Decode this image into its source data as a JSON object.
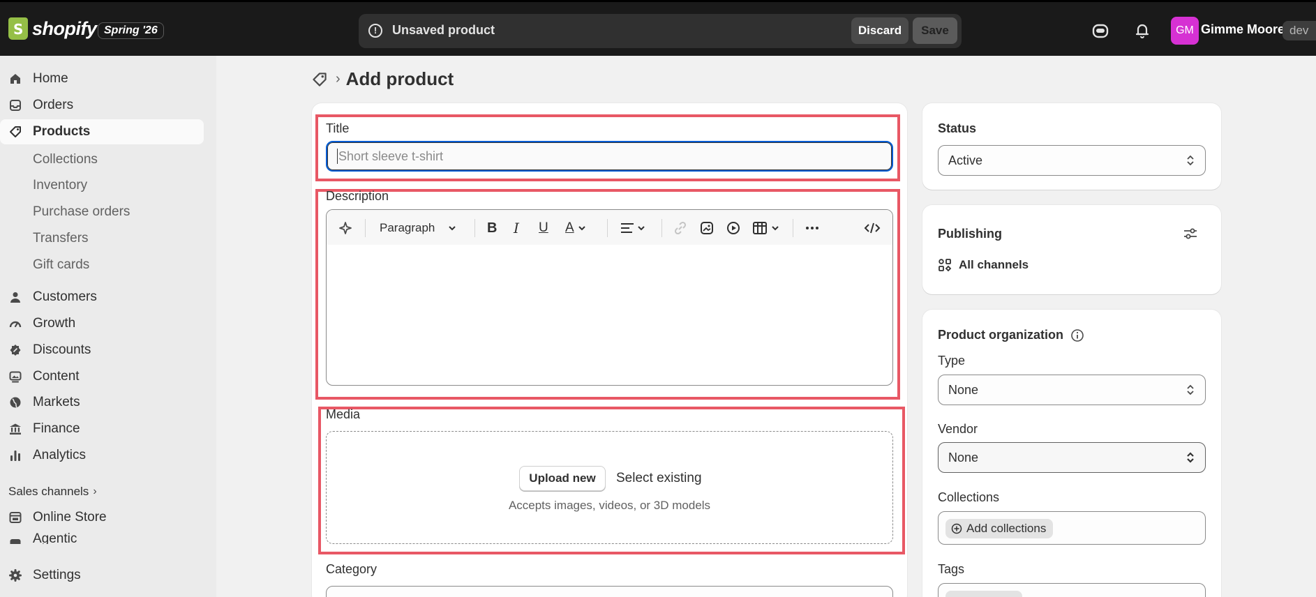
{
  "topbar": {
    "brand": "shopify",
    "edition": "Spring '26",
    "unsaved_text": "Unsaved product",
    "discard_label": "Discard",
    "save_label": "Save",
    "avatar_initials": "GM",
    "user_name": "Gimme Moore",
    "store_label": "dev"
  },
  "sidebar": {
    "items": [
      {
        "label": "Home",
        "icon": "home-icon"
      },
      {
        "label": "Orders",
        "icon": "inbox-icon"
      },
      {
        "label": "Products",
        "icon": "tag-icon",
        "active": true
      }
    ],
    "product_subitems": [
      "Collections",
      "Inventory",
      "Purchase orders",
      "Transfers",
      "Gift cards"
    ],
    "items2": [
      {
        "label": "Customers",
        "icon": "person-icon"
      },
      {
        "label": "Growth",
        "icon": "gauge-icon"
      },
      {
        "label": "Discounts",
        "icon": "discount-icon"
      },
      {
        "label": "Content",
        "icon": "image-icon"
      },
      {
        "label": "Markets",
        "icon": "globe-icon"
      },
      {
        "label": "Finance",
        "icon": "bank-icon"
      },
      {
        "label": "Analytics",
        "icon": "bar-chart-icon"
      }
    ],
    "sales_channels_label": "Sales channels",
    "channels": [
      {
        "label": "Online Store",
        "icon": "store-icon"
      },
      {
        "label": "Agentic",
        "icon": "agent-icon"
      }
    ],
    "settings_label": "Settings"
  },
  "page": {
    "title": "Add product"
  },
  "main": {
    "title_label": "Title",
    "title_placeholder": "Short sleeve t-shirt",
    "description_label": "Description",
    "toolbar_paragraph": "Paragraph",
    "media_label": "Media",
    "upload_new": "Upload new",
    "select_existing": "Select existing",
    "media_hint": "Accepts images, videos, or 3D models",
    "category_label": "Category"
  },
  "side": {
    "status_heading": "Status",
    "status_value": "Active",
    "publishing_heading": "Publishing",
    "all_channels": "All channels",
    "org_heading": "Product organization",
    "type_label": "Type",
    "type_value": "None",
    "vendor_label": "Vendor",
    "vendor_value": "None",
    "collections_label": "Collections",
    "add_collections": "Add collections",
    "tags_label": "Tags"
  }
}
